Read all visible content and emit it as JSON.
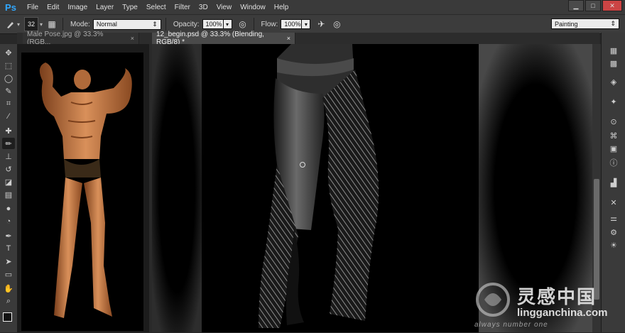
{
  "app": {
    "logo": "Ps"
  },
  "menu": [
    "File",
    "Edit",
    "Image",
    "Layer",
    "Type",
    "Select",
    "Filter",
    "3D",
    "View",
    "Window",
    "Help"
  ],
  "window_controls": {
    "minimize": "▁",
    "maximize": "□",
    "close": "✕"
  },
  "options": {
    "brush_size": "32",
    "mode_label": "Mode:",
    "mode_value": "Normal",
    "opacity_label": "Opacity:",
    "opacity_value": "100%",
    "flow_label": "Flow:",
    "flow_value": "100%",
    "workspace": "Painting"
  },
  "tabs": [
    {
      "label": "Male Pose.jpg @ 33.3% (RGB...",
      "close": "×"
    },
    {
      "label": "12_begin.psd @ 33.3% (Blending, RGB/8) *",
      "close": "×"
    }
  ],
  "tools": [
    "move-tool-icon",
    "marquee-tool-icon",
    "lasso-tool-icon",
    "quick-select-tool-icon",
    "crop-tool-icon",
    "eyedropper-tool-icon",
    "spot-heal-tool-icon",
    "brush-tool-icon",
    "clone-stamp-tool-icon",
    "history-brush-tool-icon",
    "eraser-tool-icon",
    "gradient-tool-icon",
    "blur-tool-icon",
    "dodge-tool-icon",
    "pen-tool-icon",
    "type-tool-icon",
    "path-select-tool-icon",
    "shape-tool-icon",
    "hand-tool-icon",
    "zoom-tool-icon"
  ],
  "tool_glyphs": [
    "✥",
    "⬚",
    "◯",
    "✎",
    "⌗",
    "⁄",
    "✚",
    "✏",
    "⊥",
    "↺",
    "◪",
    "▤",
    "●",
    "◔",
    "✒",
    "T",
    "➤",
    "▭",
    "✋",
    "⌕"
  ],
  "panel_icons": [
    "color-panel-icon",
    "swatches-panel-icon",
    "layers-panel-icon",
    "brush-panel-icon",
    "channels-panel-icon",
    "paths-panel-icon",
    "history-panel-icon",
    "info-panel-icon",
    "adjustments-panel-icon",
    "actions-panel-icon",
    "properties-panel-icon",
    "character-panel-icon",
    "navigator-panel-icon"
  ],
  "panel_glyphs": [
    "▦",
    "▩",
    "◈",
    "✦",
    "⊙",
    "⌘",
    "▣",
    "ⓘ",
    "▟",
    "✕",
    "⚌",
    "⚙",
    "☀"
  ],
  "watermark": {
    "chinese": "灵感中国",
    "url": "lingganchina.com",
    "tagline": "always number one"
  }
}
